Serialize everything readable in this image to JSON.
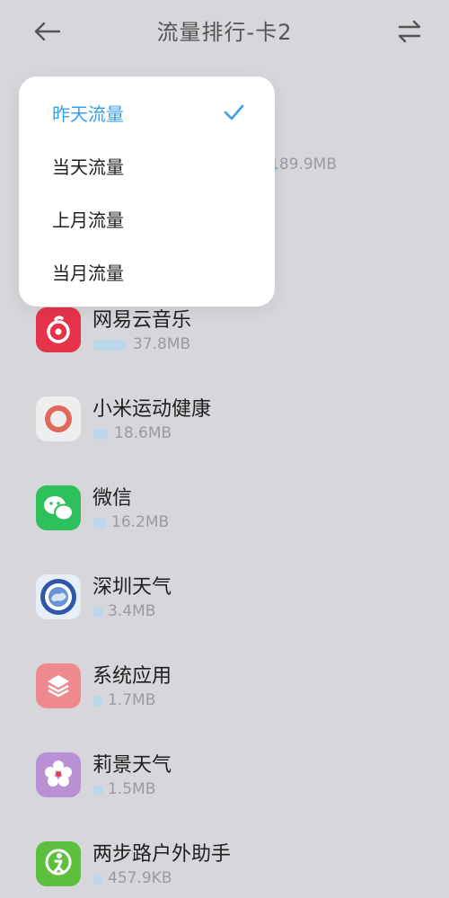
{
  "header": {
    "title": "流量排行-卡2",
    "back_icon": "arrow-left-icon",
    "switch_icon": "swap-arrows-icon"
  },
  "dropdown": {
    "items": [
      {
        "label": "昨天流量",
        "selected": true
      },
      {
        "label": "当天流量",
        "selected": false
      },
      {
        "label": "上月流量",
        "selected": false
      },
      {
        "label": "当月流量",
        "selected": false
      }
    ],
    "check_icon": "checkmark-icon",
    "accent_color": "#3aa0e6"
  },
  "peek_usage": "189.9MB",
  "apps": [
    {
      "name": "网易云音乐",
      "usage": "37.8MB",
      "share": 0.2,
      "icon": "netease-music-icon"
    },
    {
      "name": "小米运动健康",
      "usage": "18.6MB",
      "share": 0.098,
      "icon": "mi-fitness-icon"
    },
    {
      "name": "微信",
      "usage": "16.2MB",
      "share": 0.085,
      "icon": "wechat-icon"
    },
    {
      "name": "深圳天气",
      "usage": "3.4MB",
      "share": 0.018,
      "icon": "shenzhen-weather-icon"
    },
    {
      "name": "系统应用",
      "usage": "1.7MB",
      "share": 0.009,
      "icon": "system-apps-icon"
    },
    {
      "name": "莉景天气",
      "usage": "1.5MB",
      "share": 0.008,
      "icon": "lijing-weather-icon"
    },
    {
      "name": "两步路户外助手",
      "usage": "457.9KB",
      "share": 0.002,
      "icon": "liangbulu-outdoor-icon"
    }
  ]
}
